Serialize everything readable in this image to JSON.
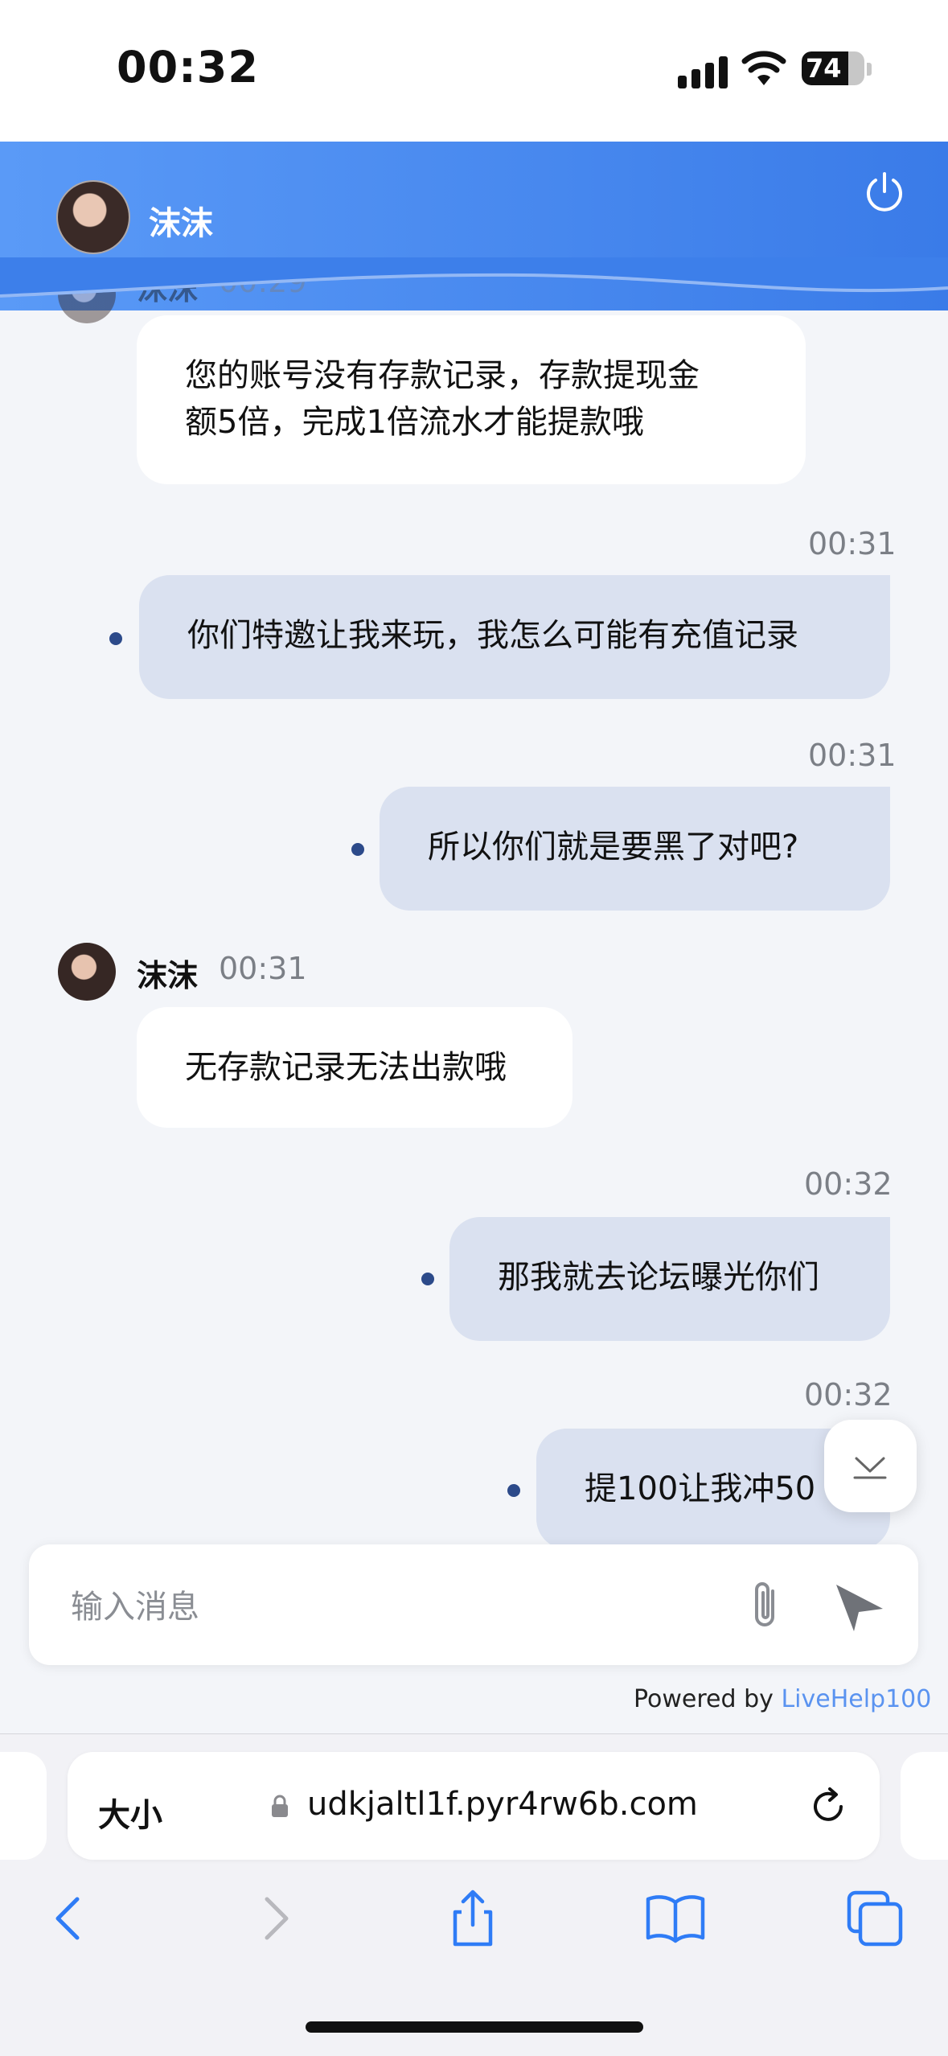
{
  "status_bar": {
    "time": "00:32",
    "battery": "74",
    "battery_level": 0.74
  },
  "header": {
    "agent_name": "沫沫",
    "power_icon": "power-icon"
  },
  "messages": [
    {
      "type": "agent_partial",
      "name": "沫沫",
      "time": "00:29",
      "lines": [
        "您的账号没有存款记录，存款提现金",
        "额5倍，完成1倍流水才能提款哦"
      ]
    },
    {
      "type": "user",
      "time": "00:31",
      "text": "你们特邀让我来玩，我怎么可能有充值记录"
    },
    {
      "type": "user",
      "time": "00:31",
      "text": "所以你们就是要黑了对吧?"
    },
    {
      "type": "agent",
      "name": "沫沫",
      "time": "00:31",
      "text": "无存款记录无法出款哦"
    },
    {
      "type": "user",
      "time": "00:32",
      "text": "那我就去论坛曝光你们"
    },
    {
      "type": "user",
      "time": "00:32",
      "text": "提100让我冲50"
    }
  ],
  "input": {
    "placeholder": "输入消息"
  },
  "footer": {
    "powered_by": "Powered by",
    "brand": "LiveHelp100"
  },
  "browser": {
    "text_size_label": "大小",
    "url": "udkjaltl1f.pyr4rw6b.com"
  },
  "colors": {
    "header_start": "#5a9af7",
    "header_end": "#3a7be8",
    "user_bubble": "#dae1f0",
    "agent_bubble": "#ffffff",
    "link": "#5a93f0"
  }
}
